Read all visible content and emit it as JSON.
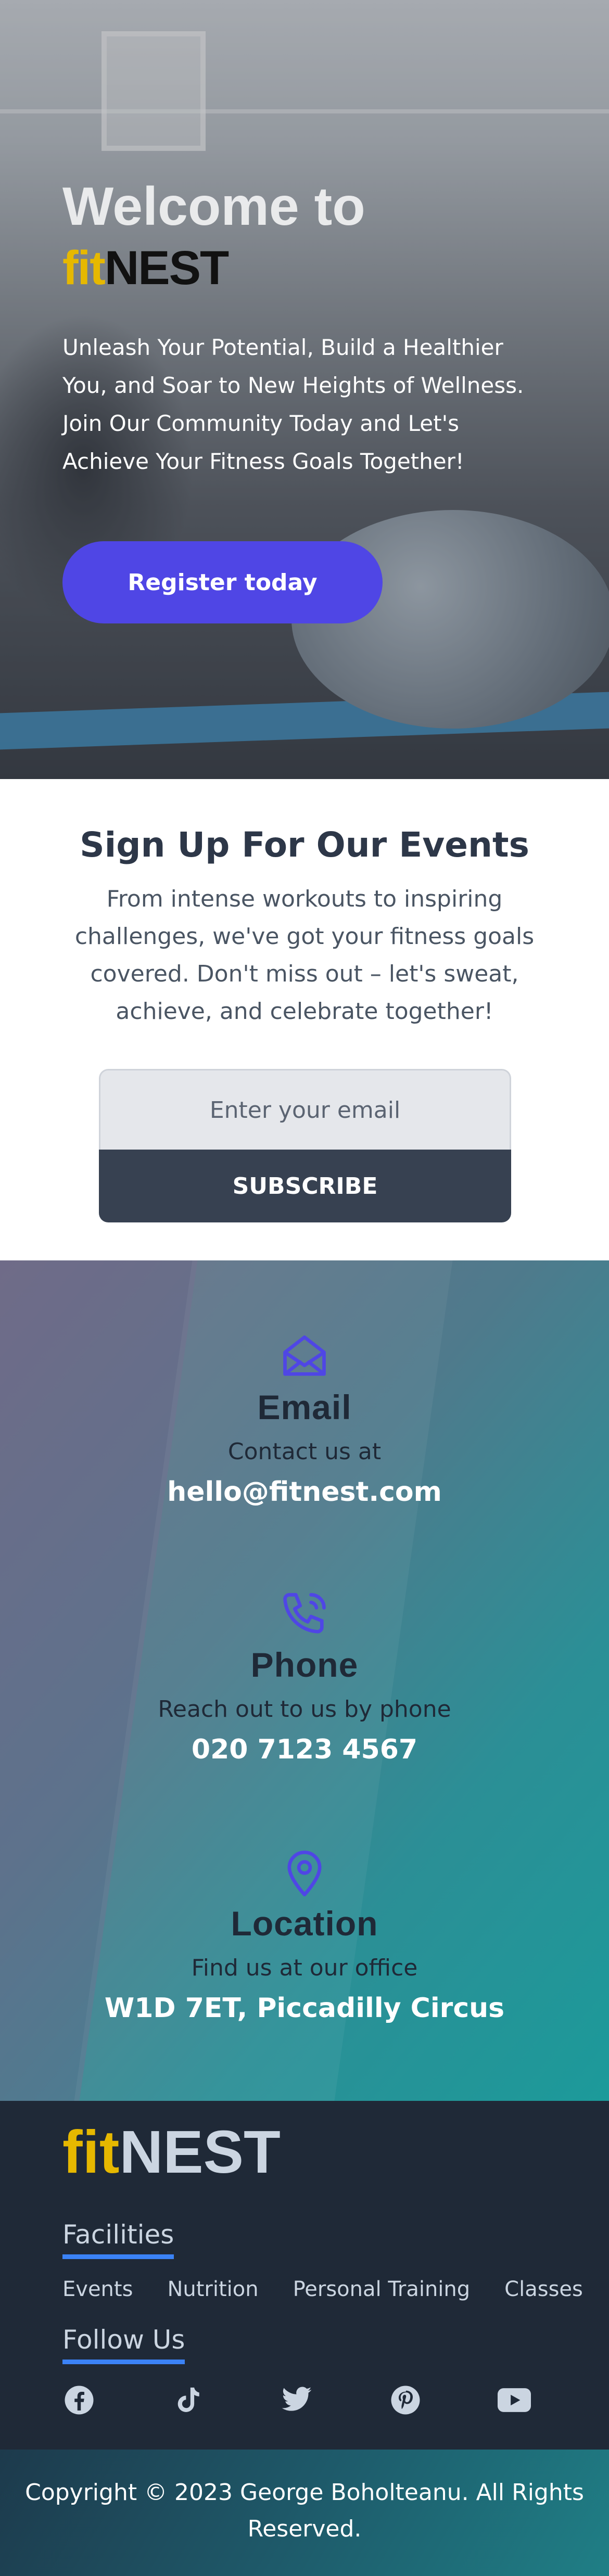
{
  "hero": {
    "title": "Welcome to",
    "logo_fit": "fit",
    "logo_nest": "NEST",
    "subtitle": "Unleash Your Potential, Build a Healthier You, and Soar to New Heights of Wellness. Join Our Community Today and Let's Achieve Your Fitness Goals Together!",
    "cta_label": "Register today"
  },
  "events": {
    "heading": "Sign Up For Our Events",
    "description": "From intense workouts to inspiring challenges, we've got your fitness goals covered. Don't miss out – let's sweat, achieve, and celebrate together!",
    "email_placeholder": "Enter your email",
    "subscribe_label": "SUBSCRIBE"
  },
  "contact": {
    "email": {
      "icon": "envelope-open-icon",
      "title": "Email",
      "desc": "Contact us at",
      "value": "hello@fitnest.com"
    },
    "phone": {
      "icon": "phone-ringing-icon",
      "title": "Phone",
      "desc": "Reach out to us by phone",
      "value": "020 7123 4567"
    },
    "location": {
      "icon": "map-pin-icon",
      "title": "Location",
      "desc": "Find us at our office",
      "value": "W1D 7ET, Piccadilly Circus"
    },
    "icon_color": "#4f46e5"
  },
  "footer": {
    "logo_fit": "fit",
    "logo_nest": "NEST",
    "facilities_heading": "Facilities",
    "facilities": [
      "Events",
      "Nutrition",
      "Personal Training",
      "Classes"
    ],
    "follow_heading": "Follow Us",
    "socials": [
      "facebook-icon",
      "tiktok-icon",
      "twitter-icon",
      "pinterest-icon",
      "youtube-icon"
    ],
    "accent": "#3b82f6"
  },
  "copyright": "Copyright © 2023 George Boholteanu. All Rights Reserved.",
  "colors": {
    "brand_yellow": "#e6b800",
    "primary": "#4f46e5",
    "dark": "#1f2937"
  }
}
